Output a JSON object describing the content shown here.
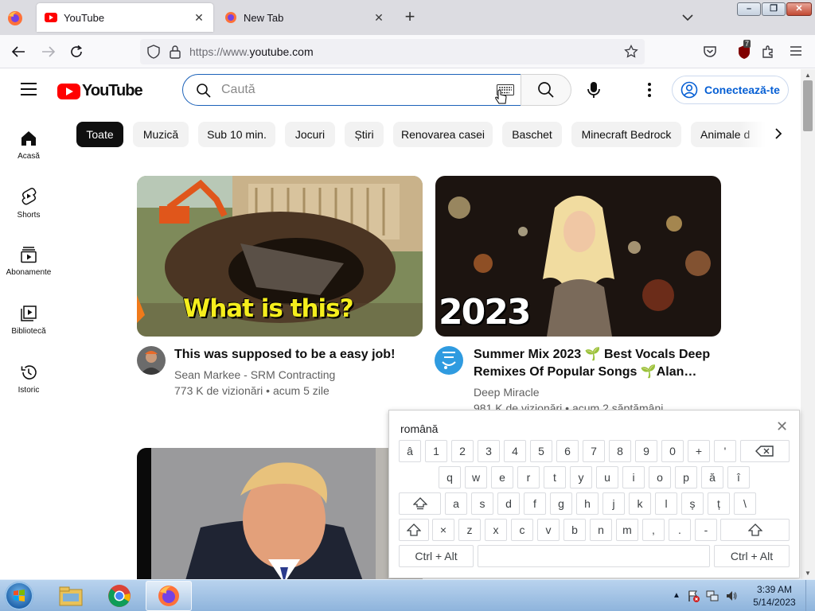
{
  "browser": {
    "tabs": [
      {
        "title": "YouTube",
        "active": true
      },
      {
        "title": "New Tab",
        "active": false
      }
    ],
    "new_tab_symbol": "+",
    "url_prefix": "https://www.",
    "url_host": "youtube.com",
    "extension_badge": "7",
    "window_controls": {
      "minimize": "–",
      "maximize": "❐",
      "close": "✕"
    }
  },
  "youtube": {
    "logo_text": "YouTube",
    "search_placeholder": "Caută",
    "sign_in_label": "Conectează-te",
    "chips": [
      "Toate",
      "Muzică",
      "Sub 10 min.",
      "Jocuri",
      "Știri",
      "Renovarea casei",
      "Baschet",
      "Minecraft Bedrock",
      "Animale d"
    ],
    "guide": [
      {
        "label": "Acasă",
        "icon": "home-icon"
      },
      {
        "label": "Shorts",
        "icon": "shorts-icon"
      },
      {
        "label": "Abonamente",
        "icon": "subscriptions-icon"
      },
      {
        "label": "Bibliotecă",
        "icon": "library-icon"
      },
      {
        "label": "Istoric",
        "icon": "history-icon"
      }
    ],
    "videos": [
      {
        "title": "This was supposed to be a easy job!",
        "channel": "Sean Markee - SRM Contracting",
        "meta": "773 K de vizionări • acum 5 zile",
        "thumb_text": "What is this?"
      },
      {
        "title_line1": "Summer Mix 2023 🌱 Best Vocals Deep",
        "title_line2": "Remixes Of Popular Songs 🌱Alan…",
        "channel": "Deep Miracle",
        "meta": "981 K de vizionări • acum 2 săptămâni",
        "thumb_text": "2023"
      }
    ]
  },
  "keyboard": {
    "language": "română",
    "close": "✕",
    "row1": [
      "â",
      "1",
      "2",
      "3",
      "4",
      "5",
      "6",
      "7",
      "8",
      "9",
      "0",
      "+",
      "'"
    ],
    "row2": [
      "q",
      "w",
      "e",
      "r",
      "t",
      "y",
      "u",
      "i",
      "o",
      "p",
      "ă",
      "î"
    ],
    "row3": [
      "a",
      "s",
      "d",
      "f",
      "g",
      "h",
      "j",
      "k",
      "l",
      "ș",
      "ț",
      "\\"
    ],
    "row4": [
      "×",
      "z",
      "x",
      "c",
      "v",
      "b",
      "n",
      "m",
      ",",
      ".",
      "-"
    ],
    "ctrl_alt": "Ctrl + Alt"
  },
  "taskbar": {
    "time": "3:39 AM",
    "date": "5/14/2023"
  },
  "colors": {
    "yt_red": "#ff0000",
    "link_blue": "#065fd4",
    "chip_active": "#0f0f0f",
    "taskbar": "#a9c6e8"
  }
}
